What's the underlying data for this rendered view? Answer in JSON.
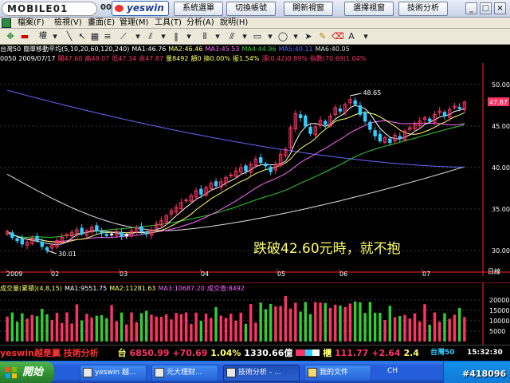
{
  "topbar": {
    "brand": "MOBILE01",
    "code": "00",
    "logo": "yeswin",
    "buttons": [
      "系統選單",
      "切換帳號",
      "開新視窗",
      "選擇視窗",
      "技術分析"
    ],
    "window_controls": [
      "_",
      "□",
      "×"
    ]
  },
  "menu": [
    "檔案(F)",
    "檢視(V)",
    "畫面(E)",
    "管理(M)",
    "工具(T)",
    "分析(A)",
    "說明(H)"
  ],
  "toolbar": {
    "dropdown_label": "權"
  },
  "info_line1": {
    "name": "台灣50",
    "indicator": "簡單移動平均(5,10,20,60,120,240)",
    "ma1": "MA1:46.76",
    "ma2": "MA2:46.46",
    "ma3": "MA3:45.53",
    "ma4": "MA4:44.96",
    "ma5": "MA5:40.11",
    "ma6": "MA6:40.05"
  },
  "info_line2": {
    "code": "0050",
    "date": "2009/07/17",
    "open": "開47.60",
    "high": "高48.07",
    "low": "低47.34",
    "close": "收47.87",
    "volume": "量8492",
    "amount": "額0",
    "turnover": "換0.00%",
    "amplitude": "振1.54%",
    "change": "漲(0.42)0.89%",
    "index": "指數(70.69)1.04%"
  },
  "chart_data": {
    "type": "candlestick",
    "price_axis": {
      "ticks": [
        "50.00",
        "45.00",
        "40.00",
        "35.00",
        "30.00"
      ],
      "tick_values": [
        50,
        45,
        40,
        35,
        30
      ],
      "ylim": [
        27.8,
        52.2
      ],
      "current_price": "47.87",
      "current_value": 47.87,
      "unit": "日線"
    },
    "x_labels": [
      "2009",
      "02",
      "03",
      "04",
      "05",
      "06",
      "07"
    ],
    "annotation": "跌破42.60元時，就不抱",
    "high_label": "48.65",
    "high_value": 48.65,
    "low_label": "30.01",
    "low_value": 30.01,
    "closes": [
      32.3,
      31.6,
      31.2,
      30.8,
      31.0,
      31.5,
      31.2,
      30.5,
      30.1,
      30.6,
      31.2,
      31.6,
      31.9,
      32.2,
      32.5,
      32.0,
      32.4,
      32.8,
      32.4,
      32.1,
      31.8,
      32.0,
      32.3,
      31.7,
      31.9,
      32.4,
      32.7,
      32.3,
      32.0,
      32.5,
      33.2,
      33.6,
      34.2,
      34.8,
      35.2,
      35.8,
      36.1,
      36.6,
      37.2,
      36.8,
      37.6,
      38.1,
      37.8,
      38.3,
      38.8,
      39.1,
      39.6,
      40.0,
      39.6,
      40.4,
      41.0,
      40.6,
      40.2,
      39.5,
      40.4,
      41.6,
      42.2,
      44.8,
      46.5,
      46.0,
      45.0,
      44.1,
      44.9,
      45.7,
      45.2,
      46.2,
      47.2,
      46.8,
      47.6,
      48.2,
      47.6,
      46.4,
      45.6,
      44.6,
      43.8,
      43.2,
      43.6,
      43.0,
      43.9,
      43.5,
      44.4,
      44.8,
      45.2,
      45.6,
      46.0,
      45.6,
      46.4,
      46.8,
      46.2,
      47.0,
      47.4,
      47.1,
      47.87
    ],
    "series": [
      {
        "name": "MA1",
        "color": "#ffffff"
      },
      {
        "name": "MA2",
        "color": "#ffff66"
      },
      {
        "name": "MA3",
        "color": "#ff66ff"
      },
      {
        "name": "MA4",
        "color": "#33cc33"
      },
      {
        "name": "MA5",
        "color": "#6666ff"
      },
      {
        "name": "MA6",
        "color": "#e0e0e0"
      }
    ],
    "ma_long": {
      "ma4_ends": [
        31.5,
        45.2
      ],
      "ma5_ends": [
        49.3,
        40.05
      ],
      "ma6_start": 39.2,
      "ma6_min": 32.4,
      "ma6_end": 40.1
    },
    "volume": {
      "label": "成交量(累積)(4,8,15)",
      "ma1": "MA1:9551.75",
      "ma2": "MA2:11281.63",
      "ma3": "MA3:10687.20",
      "value": "成交值:8492",
      "ticks": [
        "20000",
        "15000",
        "10000",
        "5000"
      ],
      "tick_values": [
        20000,
        15000,
        10000,
        5000
      ],
      "ylim": [
        0,
        23000
      ]
    }
  },
  "ticker": {
    "text": "yeswin越是贏 技術分析",
    "index_label": "台",
    "index_value": "6850.99",
    "index_change": "+70.69",
    "index_pct": "1.04%",
    "amount": "1330.66億",
    "otc_label": "櫃",
    "otc_value": "111.77",
    "otc_change": "+2.64",
    "otc_pct": "2.4",
    "stock": "台灣50",
    "time": "15:32:30"
  },
  "taskbar": {
    "start": "開始",
    "tasks": [
      "yeswin 越...",
      "元大理財...",
      "技術分析 - ...",
      "我的文件"
    ],
    "lang": "CH"
  },
  "watermark": "#418096",
  "colors": {
    "up": "#ff3366",
    "down": "#33ccff",
    "flat": "#ffffff",
    "annotation": "#ffff66",
    "axis": "#ff2222"
  }
}
